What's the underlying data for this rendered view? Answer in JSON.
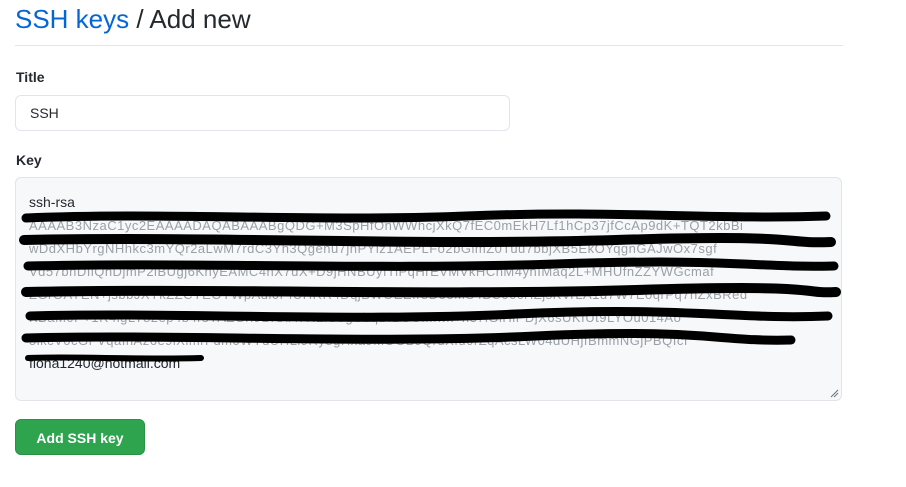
{
  "breadcrumb": {
    "parent_label": "SSH keys",
    "separator": "/",
    "current_label": "Add new"
  },
  "form": {
    "title_label": "Title",
    "title_value": "SSH",
    "key_label": "Key",
    "key_first_line": "ssh-rsa",
    "key_email_line": "fiona1240@hotmail.com",
    "submit_label": "Add SSH key"
  },
  "colors": {
    "link": "#0366d6",
    "primary_button": "#2ea44f",
    "redaction_ink": "#000000"
  }
}
